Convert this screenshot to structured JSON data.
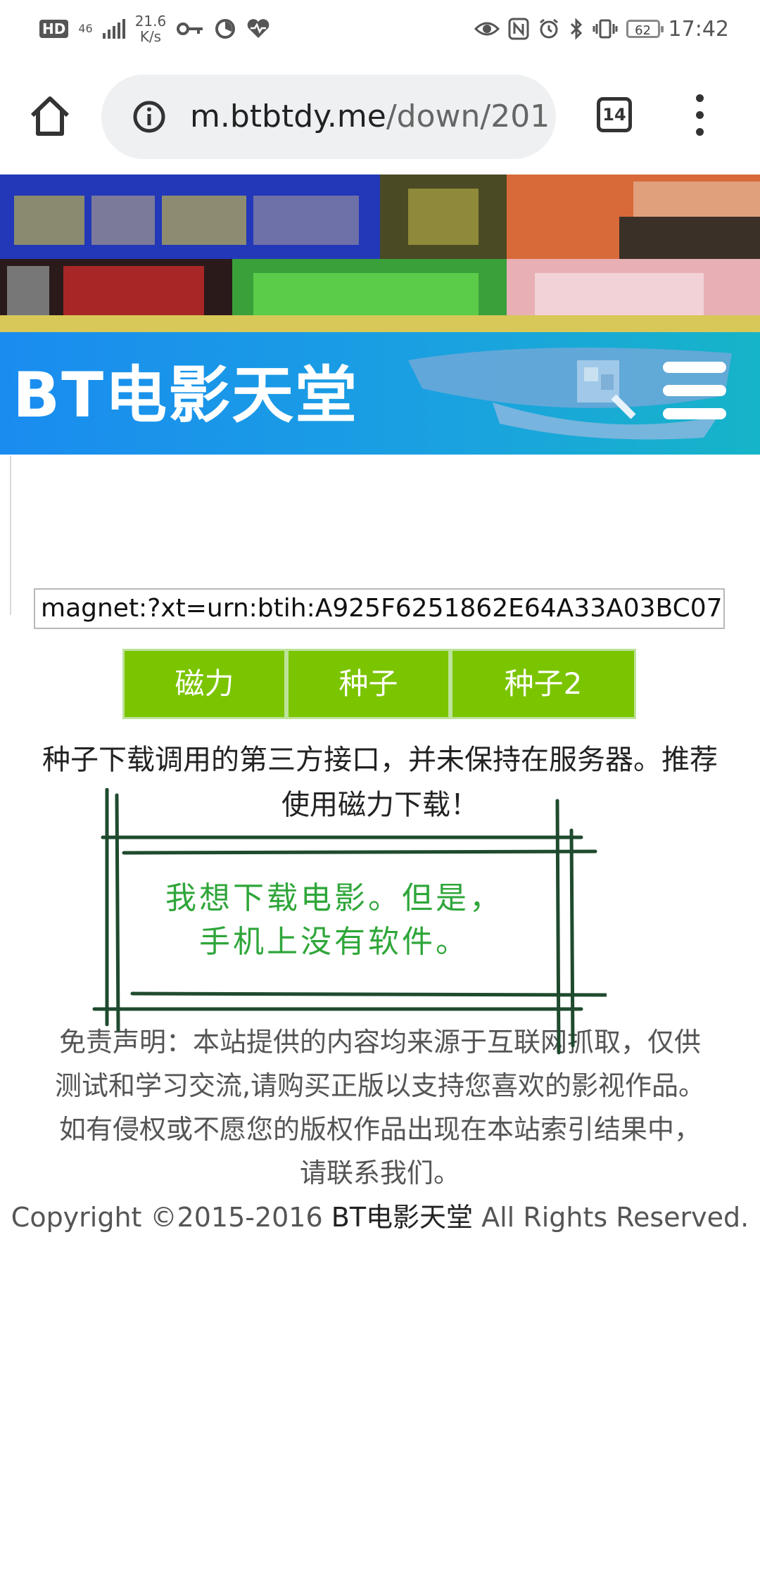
{
  "status_bar": {
    "hd": "HD",
    "network": "46",
    "speed_value": "21.6",
    "speed_unit": "K/s",
    "battery": "62",
    "time": "17:42"
  },
  "browser": {
    "url_host": "m.btbtdy.me",
    "url_path": "/down/201",
    "tab_count": "14"
  },
  "site": {
    "logo": "BT电影天堂"
  },
  "magnet": {
    "value": "magnet:?xt=urn:btih:A925F6251862E64A33A03BC07"
  },
  "buttons": {
    "magnet": "磁力",
    "torrent": "种子",
    "torrent2": "种子2"
  },
  "notice": {
    "line1": "种子下载调用的第三方接口，并未保持在服务器。推荐",
    "line2": "使用磁力下载！"
  },
  "overlay": {
    "line1": "我想下载电影。但是，",
    "line2": "手机上没有软件。"
  },
  "disclaimer": {
    "line1": "免责声明：本站提供的内容均来源于互联网抓取，仅供",
    "line2": "测试和学习交流,请购买正版以支持您喜欢的影视作品。",
    "line3": "如有侵权或不愿您的版权作品出现在本站索引结果中，",
    "line4": "请联系我们。"
  },
  "footer": {
    "copyright_prefix": "Copyright ©2015-2016 ",
    "brand": "BT电影天堂",
    "copyright_suffix": " All Rights Reserved."
  },
  "colors": {
    "header_blue": "#1a8cf0",
    "button_green": "#7bc400",
    "chalk_green": "#2fa63a",
    "chalk_frame": "#1f4a2e"
  }
}
